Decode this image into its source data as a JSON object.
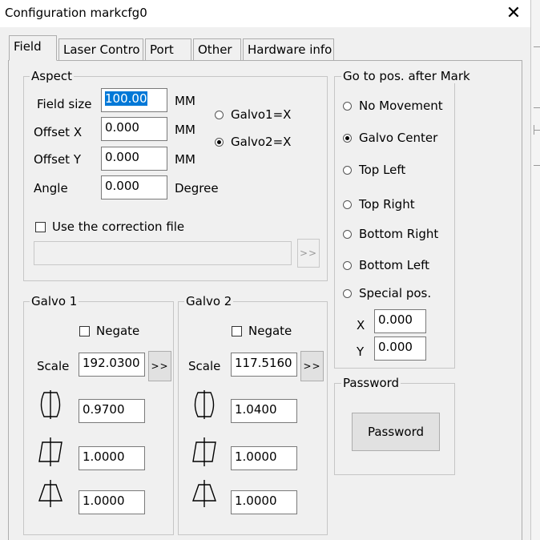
{
  "window": {
    "title": "Configuration markcfg0",
    "close_glyph": "✕"
  },
  "tabs": [
    "Field",
    "Laser Contro",
    "Port",
    "Other",
    "Hardware info"
  ],
  "aspect": {
    "label": "Aspect",
    "field_size": {
      "label": "Field size",
      "value": "100.00",
      "unit": "MM"
    },
    "offset_x": {
      "label": "Offset X",
      "value": "0.000",
      "unit": "MM"
    },
    "offset_y": {
      "label": "Offset Y",
      "value": "0.000",
      "unit": "MM"
    },
    "angle": {
      "label": "Angle",
      "value": "0.000",
      "unit": "Degree"
    },
    "galvo1_x": "Galvo1=X",
    "galvo2_x": "Galvo2=X",
    "selected_axis": "Galvo2=X",
    "use_correction": {
      "label": "Use the correction file",
      "checked": false
    },
    "correction_path": "",
    "browse_label": ">>"
  },
  "goto": {
    "label": "Go to pos. after Mark",
    "options": [
      "No Movement",
      "Galvo Center",
      "Top Left",
      "Top Right",
      "Bottom Right",
      "Bottom Left",
      "Special pos."
    ],
    "selected": "Galvo Center",
    "x_label": "X",
    "x_value": "0.000",
    "y_label": "Y",
    "y_value": "0.000"
  },
  "password": {
    "label": "Password",
    "button": "Password"
  },
  "galvo1": {
    "label": "Galvo 1",
    "negate": "Negate",
    "negate_checked": false,
    "scale_label": "Scale",
    "scale": "192.0300",
    "scale_btn": ">>",
    "barrel": "0.9700",
    "trapezoid_x": "1.0000",
    "trapezoid_y": "1.0000"
  },
  "galvo2": {
    "label": "Galvo 2",
    "negate": "Negate",
    "negate_checked": false,
    "scale_label": "Scale",
    "scale": "117.5160",
    "scale_btn": ">>",
    "barrel": "1.0400",
    "trapezoid_x": "1.0000",
    "trapezoid_y": "1.0000"
  },
  "icons": [
    "barrel-correction-icon",
    "parallelogram-correction-icon",
    "trapezoid-correction-icon"
  ]
}
